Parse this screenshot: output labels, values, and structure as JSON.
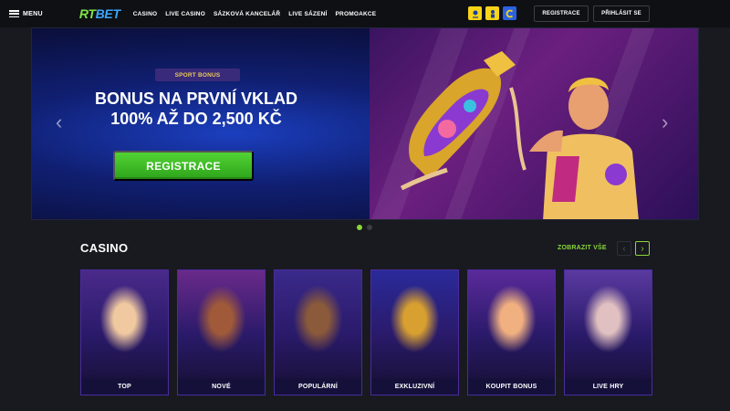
{
  "header": {
    "menu_label": "MENU",
    "logo_rt": "RT",
    "logo_bet": "BET",
    "nav": [
      "CASINO",
      "LIVE CASINO",
      "SÁZKOVÁ KANCELÁŘ",
      "LIVE SÁZENÍ",
      "PROMOAKCE"
    ],
    "register_label": "REGISTRACE",
    "login_label": "PŘIHLÁSIT SE"
  },
  "banner": {
    "badge": "SPORT BONUS",
    "headline_line1": "BONUS NA PRVNÍ VKLAD",
    "headline_line2": "100% AŽ DO 2,500 KČ",
    "cta": "REGISTRACE",
    "prev_arrow": "‹",
    "next_arrow": "›",
    "slides": 2,
    "active_slide": 1
  },
  "casino": {
    "title": "CASINO",
    "see_all": "ZOBRAZIT VŠE",
    "prev": "‹",
    "next": "›",
    "cards": [
      {
        "label": "TOP",
        "top": "#4a2a8a",
        "bottom": "#f0c9a0"
      },
      {
        "label": "NOVÉ",
        "top": "#6a2a8a",
        "bottom": "#a05a3a"
      },
      {
        "label": "POPULÁRNÍ",
        "top": "#3a2a8a",
        "bottom": "#8a5a3a"
      },
      {
        "label": "EXKLUZIVNÍ",
        "top": "#2a2a9a",
        "bottom": "#d8a030"
      },
      {
        "label": "KOUPIT BONUS",
        "top": "#5a2a9a",
        "bottom": "#f0b080"
      },
      {
        "label": "LIVE HRY",
        "top": "#5a3aa0",
        "bottom": "#e0c0c0"
      }
    ]
  },
  "colors": {
    "accent_green": "#8bd63a",
    "cta_green": "#3fbf26",
    "card_border": "#4a2b9e"
  }
}
